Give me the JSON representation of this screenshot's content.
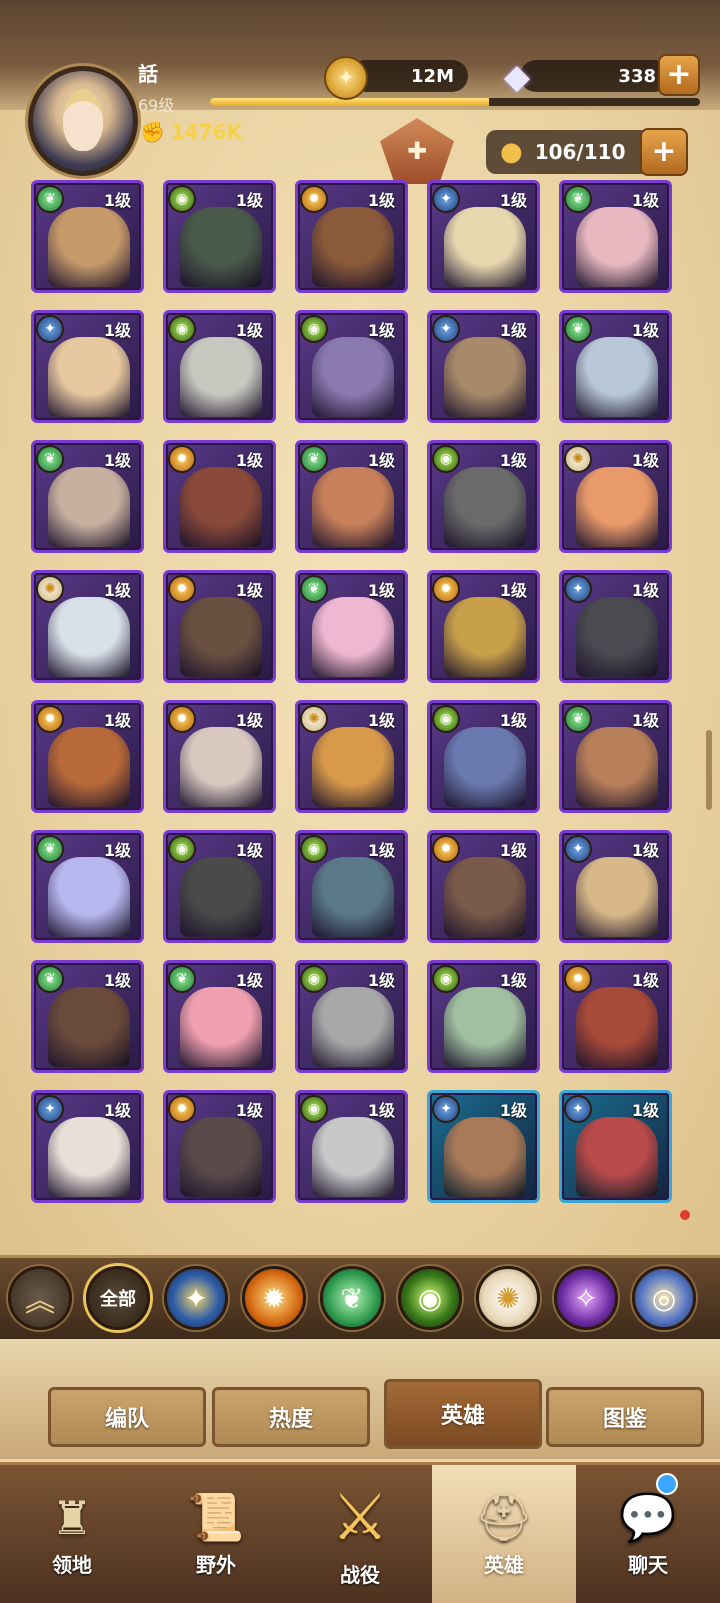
{
  "player": {
    "name": "話",
    "level": "69级",
    "power": "1476K",
    "xp_progress": 0.57
  },
  "currency": {
    "gold": "12M",
    "diamonds": "338"
  },
  "hero_capacity": "106/110",
  "heroes": [
    {
      "faction": "wilder",
      "level": "1级",
      "color": "#c79a6a",
      "frame": "purple"
    },
    {
      "faction": "graveborn",
      "level": "1级",
      "color": "#4a5a4a",
      "frame": "purple"
    },
    {
      "faction": "mauler",
      "level": "1级",
      "color": "#8a5a3a",
      "frame": "purple"
    },
    {
      "faction": "lightbearer",
      "level": "1级",
      "color": "#e8d8b0",
      "frame": "purple"
    },
    {
      "faction": "wilder",
      "level": "1级",
      "color": "#e8b8c0",
      "frame": "purple"
    },
    {
      "faction": "lightbearer",
      "level": "1级",
      "color": "#e8c8a0",
      "frame": "purple"
    },
    {
      "faction": "graveborn",
      "level": "1级",
      "color": "#c8c8c0",
      "frame": "purple"
    },
    {
      "faction": "graveborn",
      "level": "1级",
      "color": "#8a7ab0",
      "frame": "purple"
    },
    {
      "faction": "lightbearer",
      "level": "1级",
      "color": "#a88a6a",
      "frame": "purple"
    },
    {
      "faction": "wilder",
      "level": "1级",
      "color": "#b8c8d8",
      "frame": "purple"
    },
    {
      "faction": "wilder",
      "level": "1级",
      "color": "#c8b0a0",
      "frame": "purple"
    },
    {
      "faction": "mauler",
      "level": "1级",
      "color": "#8a4a3a",
      "frame": "purple"
    },
    {
      "faction": "wilder",
      "level": "1级",
      "color": "#c8805a",
      "frame": "purple"
    },
    {
      "faction": "graveborn",
      "level": "1级",
      "color": "#6a6a6a",
      "frame": "purple"
    },
    {
      "faction": "celestial",
      "level": "1级",
      "color": "#e89a6a",
      "frame": "purple"
    },
    {
      "faction": "celestial",
      "level": "1级",
      "color": "#d8e0e8",
      "frame": "purple"
    },
    {
      "faction": "mauler",
      "level": "1级",
      "color": "#6a5040",
      "frame": "purple"
    },
    {
      "faction": "wilder",
      "level": "1级",
      "color": "#f0b8d0",
      "frame": "purple"
    },
    {
      "faction": "mauler",
      "level": "1级",
      "color": "#c8a04a",
      "frame": "purple"
    },
    {
      "faction": "lightbearer",
      "level": "1级",
      "color": "#4a4a50",
      "frame": "purple"
    },
    {
      "faction": "mauler",
      "level": "1级",
      "color": "#b86a3a",
      "frame": "purple"
    },
    {
      "faction": "mauler",
      "level": "1级",
      "color": "#d8c8c0",
      "frame": "purple"
    },
    {
      "faction": "celestial",
      "level": "1级",
      "color": "#d89a4a",
      "frame": "purple"
    },
    {
      "faction": "graveborn",
      "level": "1级",
      "color": "#6a7ab0",
      "frame": "purple"
    },
    {
      "faction": "wilder",
      "level": "1级",
      "color": "#b8805a",
      "frame": "purple"
    },
    {
      "faction": "wilder",
      "level": "1级",
      "color": "#b8b8f0",
      "frame": "purple"
    },
    {
      "faction": "graveborn",
      "level": "1级",
      "color": "#4a4a4a",
      "frame": "purple"
    },
    {
      "faction": "graveborn",
      "level": "1级",
      "color": "#5a7a8a",
      "frame": "purple"
    },
    {
      "faction": "mauler",
      "level": "1级",
      "color": "#7a5a4a",
      "frame": "purple"
    },
    {
      "faction": "lightbearer",
      "level": "1级",
      "color": "#d8b888",
      "frame": "purple"
    },
    {
      "faction": "wilder",
      "level": "1级",
      "color": "#6a4a3a",
      "frame": "purple"
    },
    {
      "faction": "wilder",
      "level": "1级",
      "color": "#f0a0b0",
      "frame": "purple"
    },
    {
      "faction": "graveborn",
      "level": "1级",
      "color": "#a8a8a8",
      "frame": "purple"
    },
    {
      "faction": "graveborn",
      "level": "1级",
      "color": "#a0c0a0",
      "frame": "purple"
    },
    {
      "faction": "mauler",
      "level": "1级",
      "color": "#a84a3a",
      "frame": "purple"
    },
    {
      "faction": "lightbearer",
      "level": "1级",
      "color": "#e8e0d8",
      "frame": "purple"
    },
    {
      "faction": "mauler",
      "level": "1级",
      "color": "#5a4a4a",
      "frame": "purple"
    },
    {
      "faction": "graveborn",
      "level": "1级",
      "color": "#c8c8c8",
      "frame": "purple"
    },
    {
      "faction": "lightbearer",
      "level": "1级",
      "color": "#a87a5a",
      "frame": "blue"
    },
    {
      "faction": "lightbearer",
      "level": "1级",
      "color": "#b84a4a",
      "frame": "blue"
    }
  ],
  "faction_filters": [
    {
      "id": "collapse",
      "icon": "chevron-up-icon"
    },
    {
      "id": "all",
      "label": "全部"
    },
    {
      "id": "lightbearer",
      "icon": "star-compass-icon"
    },
    {
      "id": "mauler",
      "icon": "mauler-icon"
    },
    {
      "id": "wilder",
      "icon": "leaf-icon"
    },
    {
      "id": "graveborn",
      "icon": "eye-icon"
    },
    {
      "id": "celestial",
      "icon": "star-burst-icon"
    },
    {
      "id": "hypogean",
      "icon": "dark-star-icon"
    },
    {
      "id": "dimensional",
      "icon": "dimensional-icon"
    }
  ],
  "tabs": [
    "编队",
    "热度",
    "英雄",
    "图鉴"
  ],
  "active_tab": "英雄",
  "bottom_nav": [
    {
      "label": "领地",
      "icon": "castle-icon"
    },
    {
      "label": "野外",
      "icon": "scroll-map-icon"
    },
    {
      "label": "战役",
      "icon": "battle-crest-icon"
    },
    {
      "label": "英雄",
      "icon": "helmet-icon"
    },
    {
      "label": "聊天",
      "icon": "chat-icon"
    }
  ],
  "active_nav": "英雄"
}
